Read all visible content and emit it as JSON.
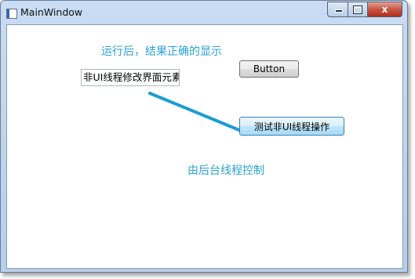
{
  "window": {
    "title": "MainWindow",
    "close_glyph": "x",
    "icons": [
      "app-icon",
      "minimize-icon",
      "maximize-icon",
      "close-icon"
    ]
  },
  "client": {
    "hint_run": "运行后，结果正确的显示",
    "textbox_value": "非UI线程修改界面元素",
    "button_label": "Button",
    "test_button_label": "测试非UI线程操作",
    "hint_background": "由后台线程控制"
  },
  "colors": {
    "annotation": "#2aa0d6",
    "arrow": "#1b9bd6"
  }
}
